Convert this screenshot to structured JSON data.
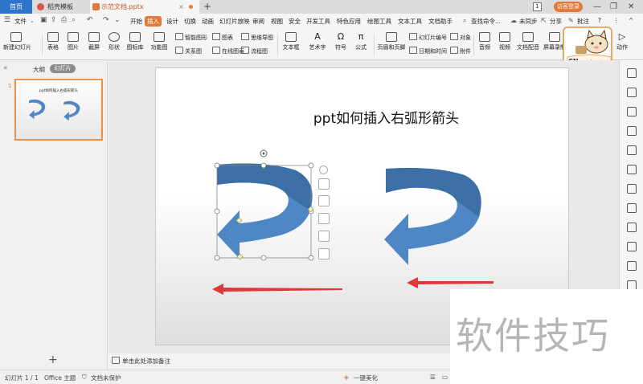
{
  "titlebar": {
    "home_tab": "首页",
    "template_tab": "稻壳模板",
    "doc_tab": "示范文档.pptx",
    "tab_close": "×",
    "new_tab": "+",
    "window_count": "1",
    "visitor_login": "访客登录",
    "min": "—",
    "max": "❐",
    "close": "✕"
  },
  "menubar": {
    "file": "文件",
    "items": [
      "开始",
      "插入",
      "设计",
      "切换",
      "动画",
      "幻灯片放映",
      "审阅",
      "视图",
      "安全",
      "开发工具",
      "特色应用",
      "绘图工具",
      "文本工具",
      "文档助手"
    ],
    "active_item": "插入",
    "search": "查找命令...",
    "sync": "未同步",
    "share": "分享",
    "comment": "批注",
    "help": "?",
    "more": "⋮",
    "collapse": "^"
  },
  "ribbon": {
    "new_slide": "新建幻灯片",
    "table": "表格",
    "picture": "图片",
    "screenshot": "截屏",
    "shape": "形状",
    "icon_lib": "图标库",
    "function_chart": "功能图",
    "smart_graphic": "智能图形",
    "chart": "图表",
    "mind_map": "思维导图",
    "relation_chart": "关系图",
    "online_chart": "在线图表",
    "flowchart": "流程图",
    "textbox": "文本框",
    "art_text": "艺术字",
    "symbol": "符号",
    "formula": "公式",
    "header_footer": "页眉和页脚",
    "slide_number": "幻灯片编号",
    "object": "对象",
    "date_time": "日期和时间",
    "attachment": "附件",
    "audio": "音频",
    "video": "视频",
    "doc_dub": "文档配音",
    "screen_record": "屏幕录制",
    "action": "动作"
  },
  "mascot": {
    "text": "CN"
  },
  "left_panel": {
    "outline_tab": "大纲",
    "slides_tab": "幻灯片",
    "slide_number": "1",
    "thumb_title": "ppt如何插入右弧形箭头",
    "add": "+"
  },
  "slide": {
    "title": "ppt如何插入右弧形箭头",
    "shape_color": "#4f87c4",
    "shape_dark": "#3c6fa6",
    "arrow_color": "#e0383a"
  },
  "notes": {
    "placeholder": "单击此处添加备注"
  },
  "statusbar": {
    "slide_count": "幻灯片 1 / 1",
    "theme": "Office 主题",
    "protect": "文档未保护",
    "beautify": "一键美化"
  },
  "watermark": {
    "text": "软件技巧"
  }
}
